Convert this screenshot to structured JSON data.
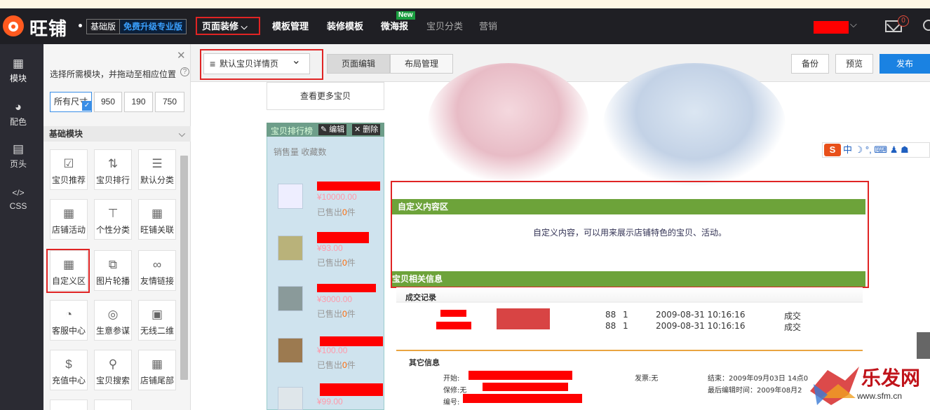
{
  "topbar": {
    "brand": "旺铺",
    "edition": "基础版",
    "upgrade": "免费升级专业版",
    "nav": [
      "页面装修",
      "模板管理",
      "装修模板",
      "微海报",
      "宝贝分类",
      "营销"
    ],
    "new_badge": "New",
    "mail_count": "0"
  },
  "tools": [
    "模块",
    "配色",
    "页头",
    "CSS"
  ],
  "panel": {
    "hint": "选择所需模块，并拖动至相应位置",
    "sizes": [
      "所有尺寸",
      "950",
      "190",
      "750"
    ],
    "section": "基础模块",
    "modules": [
      "宝贝推荐",
      "宝贝排行",
      "默认分类",
      "店铺活动",
      "个性分类",
      "旺铺关联",
      "自定义区",
      "图片轮播",
      "友情链接",
      "客服中心",
      "生意参谋",
      "无线二维",
      "充值中心",
      "宝贝搜索",
      "店铺尾部"
    ]
  },
  "toolbar": {
    "page_select": "默认宝贝详情页",
    "tabs": [
      "页面编辑",
      "布局管理"
    ],
    "buttons": [
      "备份",
      "预览",
      "发布"
    ]
  },
  "canvas": {
    "more": "查看更多宝贝",
    "col_title": "宝贝排行榜",
    "edit": "编辑",
    "delete": "删除",
    "col_tabs": [
      "销售量",
      "收藏数"
    ],
    "items": [
      {
        "price": "¥10000.00",
        "sold_pre": "已售出",
        "sold_num": "0",
        "sold_post": "件"
      },
      {
        "price": "¥93.00",
        "sold_pre": "已售出",
        "sold_num": "0",
        "sold_post": "件"
      },
      {
        "price": "¥3000.00",
        "sold_pre": "已售出",
        "sold_num": "0",
        "sold_post": "件"
      },
      {
        "price": "¥100.00",
        "sold_pre": "已售出",
        "sold_num": "0",
        "sold_post": "件"
      },
      {
        "price": "¥99.00",
        "sold_pre": "",
        "sold_num": "",
        "sold_post": ""
      }
    ],
    "custom_title": "自定义内容区",
    "custom_text": "自定义内容，可以用来展示店铺特色的宝贝、活动。",
    "related_title": "宝贝相关信息",
    "record_title": "成交记录",
    "records": [
      {
        "price": "88",
        "qty": "1",
        "time": "2009-08-31 10:16:16",
        "status": "成交"
      },
      {
        "price": "88",
        "qty": "1",
        "time": "2009-08-31 10:16:16",
        "status": "成交"
      }
    ],
    "other_title": "其它信息",
    "other": {
      "start": "开始:",
      "invoice": "发票:无",
      "end": "结束：2009年09月03日 14点0",
      "warranty": "保修:无",
      "last_edit": "最后编辑时间：2009年08月2",
      "code": "编号:"
    },
    "ime": "中"
  },
  "watermark": {
    "text": "乐发网",
    "url": "www.sfm.cn"
  }
}
